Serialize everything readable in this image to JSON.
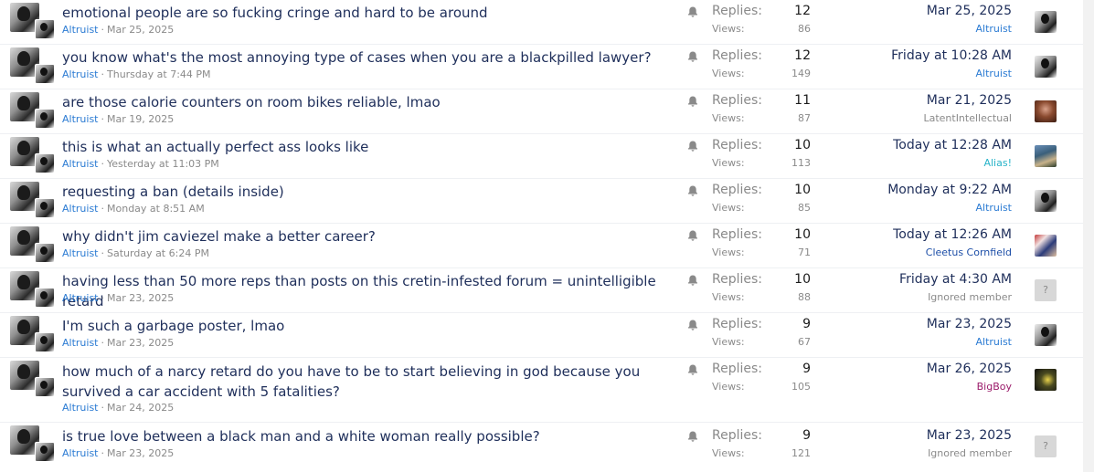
{
  "labels": {
    "replies": "Replies:",
    "views": "Views:",
    "meta_sep": "·"
  },
  "threads": [
    {
      "title": "emotional people are so fucking cringe and hard to be around",
      "author": "Altruist",
      "started": "Mar 25, 2025",
      "replies": "12",
      "views": "86",
      "last_date": "Mar 25, 2025",
      "last_user": "Altruist",
      "last_icon": "user-avatar"
    },
    {
      "title": "you know what's the most annoying type of cases when you are a blackpilled lawyer?",
      "author": "Altruist",
      "started": "Thursday at 7:44 PM",
      "replies": "12",
      "views": "149",
      "last_date": "Friday at 10:28 AM",
      "last_user": "Altruist",
      "last_icon": "user-avatar"
    },
    {
      "title": "are those calorie counters on room bikes reliable, lmao",
      "author": "Altruist",
      "started": "Mar 19, 2025",
      "replies": "11",
      "views": "87",
      "last_date": "Mar 21, 2025",
      "last_user": "LatentIntellectual",
      "last_icon": "user-avatar"
    },
    {
      "title": "this is what an actually perfect ass looks like",
      "author": "Altruist",
      "started": "Yesterday at 11:03 PM",
      "replies": "10",
      "views": "113",
      "last_date": "Today at 12:28 AM",
      "last_user": "Alias!",
      "last_icon": "user-avatar"
    },
    {
      "title": "requesting a ban (details inside)",
      "author": "Altruist",
      "started": "Monday at 8:51 AM",
      "replies": "10",
      "views": "85",
      "last_date": "Monday at 9:22 AM",
      "last_user": "Altruist",
      "last_icon": "user-avatar"
    },
    {
      "title": "why didn't jim caviezel make a better career?",
      "author": "Altruist",
      "started": "Saturday at 6:24 PM",
      "replies": "10",
      "views": "71",
      "last_date": "Today at 12:26 AM",
      "last_user": "Cleetus Cornfield",
      "last_icon": "user-avatar"
    },
    {
      "title": "having less than 50 more reps than posts on this cretin-infested forum = unintelligible retard",
      "author": "Altruist",
      "started": "Mar 23, 2025",
      "replies": "10",
      "views": "88",
      "last_date": "Friday at 4:30 AM",
      "last_user": "Ignored member",
      "last_icon": "ignored-avatar",
      "last_icon_text": "?"
    },
    {
      "title": "I'm such a garbage poster, lmao",
      "author": "Altruist",
      "started": "Mar 23, 2025",
      "replies": "9",
      "views": "67",
      "last_date": "Mar 23, 2025",
      "last_user": "Altruist",
      "last_icon": "user-avatar"
    },
    {
      "title": "how much of a narcy retard do you have to be to start believing in god because you survived a car accident with 5 fatalities?",
      "author": "Altruist",
      "started": "Mar 24, 2025",
      "replies": "9",
      "views": "105",
      "last_date": "Mar 26, 2025",
      "last_user": "BigBoy",
      "last_icon": "user-avatar"
    },
    {
      "title": "is true love between a black man and a white woman really possible?",
      "author": "Altruist",
      "started": "Mar 23, 2025",
      "replies": "9",
      "views": "121",
      "last_date": "Mar 23, 2025",
      "last_user": "Ignored member",
      "last_icon": "ignored-avatar",
      "last_icon_text": "?"
    }
  ],
  "colors": {
    "title": "#1e2e5a",
    "author_link": "#2b7bd3",
    "muted": "#8a8a8a",
    "user_LatentIntellectual": "#8a8a8a",
    "user_Alias": "#27b3c9",
    "user_Cleetus": "#1e4fa8",
    "user_BigBoy": "#9b1b6a"
  }
}
